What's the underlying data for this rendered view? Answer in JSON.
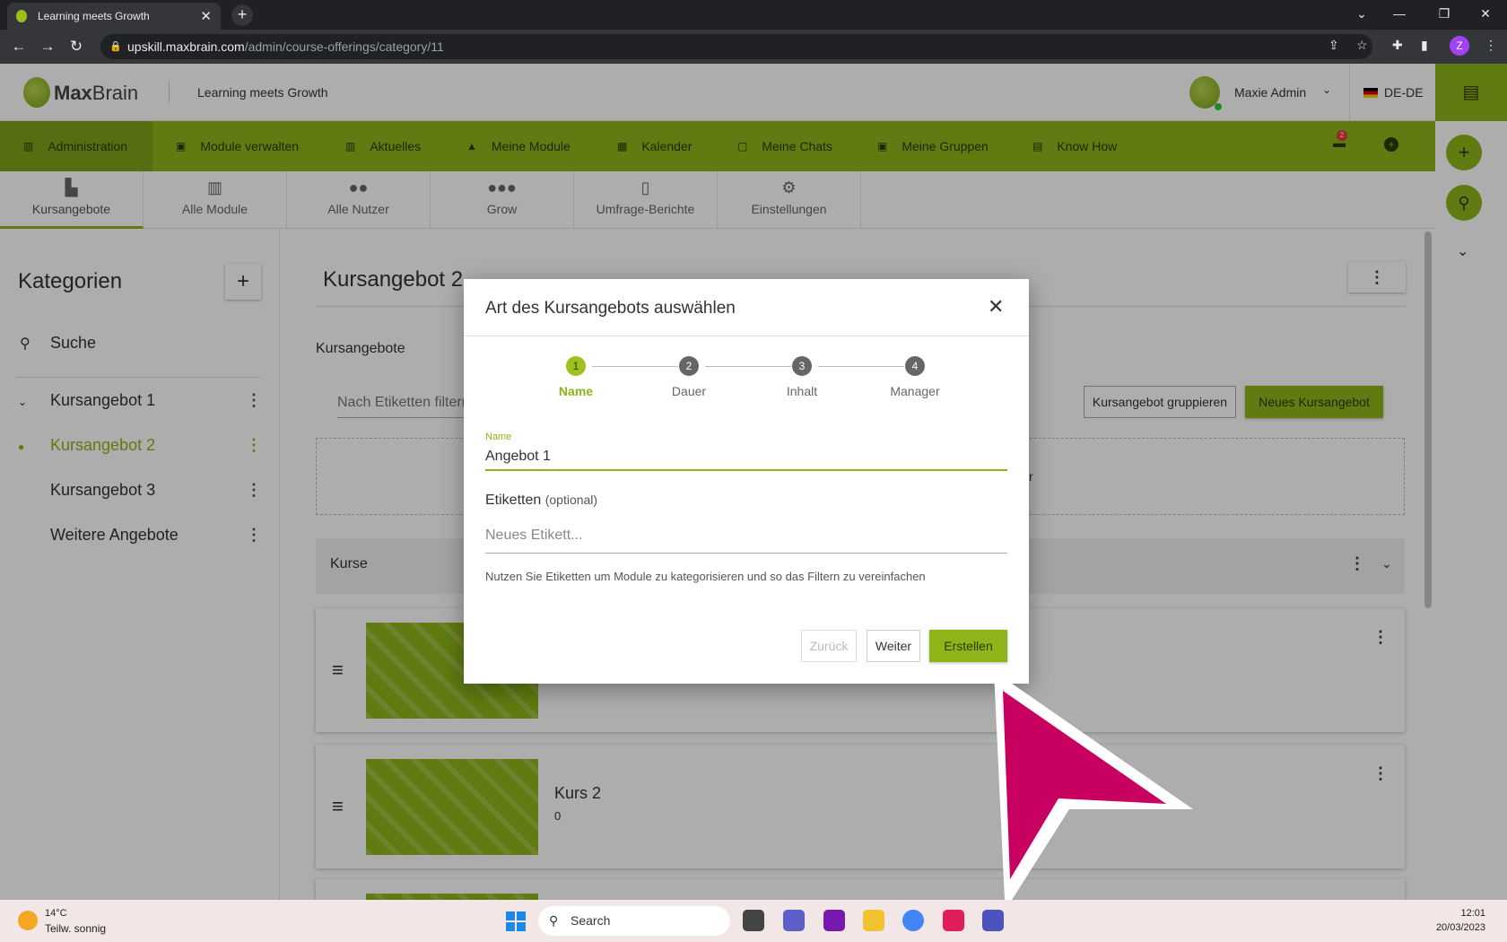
{
  "browser": {
    "tab_title": "Learning meets Growth",
    "url_host": "upskill.maxbrain.com",
    "url_path": "/admin/course-offerings/category/11",
    "profile_initial": "Z"
  },
  "header": {
    "logo_max": "Max",
    "logo_brain": "Brain",
    "tagline": "Learning meets Growth",
    "user_name": "Maxie Admin",
    "language": "DE-DE"
  },
  "nav": {
    "items": [
      {
        "label": "Administration"
      },
      {
        "label": "Module verwalten"
      },
      {
        "label": "Aktuelles"
      },
      {
        "label": "Meine Module"
      },
      {
        "label": "Kalender"
      },
      {
        "label": "Meine Chats"
      },
      {
        "label": "Meine Gruppen"
      },
      {
        "label": "Know How"
      }
    ],
    "notification_count": "2"
  },
  "subtabs": [
    {
      "label": "Kursangebote"
    },
    {
      "label": "Alle Module"
    },
    {
      "label": "Alle Nutzer"
    },
    {
      "label": "Grow"
    },
    {
      "label": "Umfrage-Berichte"
    },
    {
      "label": "Einstellungen"
    }
  ],
  "sidebar": {
    "title": "Kategorien",
    "search_label": "Suche",
    "items": [
      {
        "label": "Kursangebot 1"
      },
      {
        "label": "Kursangebot 2"
      },
      {
        "label": "Kursangebot 3"
      },
      {
        "label": "Weitere Angebote"
      }
    ]
  },
  "main": {
    "title": "Kursangebot 2",
    "subheading": "Kursangebote",
    "filter_placeholder": "Nach Etiketten filtern",
    "group_button": "Kursangebot gruppieren",
    "new_button": "Neues Kursangebot",
    "drop_fragment": "r",
    "section_label": "Kurse",
    "cards": [
      {
        "title": "",
        "subtitle": ""
      },
      {
        "title": "Kurs 2",
        "subtitle": "0"
      }
    ]
  },
  "modal": {
    "title": "Art des Kursangebots auswählen",
    "steps": [
      {
        "num": "1",
        "label": "Name"
      },
      {
        "num": "2",
        "label": "Dauer"
      },
      {
        "num": "3",
        "label": "Inhalt"
      },
      {
        "num": "4",
        "label": "Manager"
      }
    ],
    "name_label": "Name",
    "name_value": "Angebot 1",
    "tags_label": "Etiketten",
    "tags_optional": "(optional)",
    "tags_placeholder": "Neues Etikett...",
    "hint": "Nutzen Sie Etiketten um Module zu kategorisieren und so das Filtern zu vereinfachen",
    "back_button": "Zurück",
    "next_button": "Weiter",
    "create_button": "Erstellen"
  },
  "taskbar": {
    "temperature": "14°C",
    "weather": "Teilw. sonnig",
    "search_label": "Search",
    "time": "12:01",
    "date": "20/03/2023"
  },
  "colors": {
    "brand_green": "#8db51a",
    "cursor_magenta": "#c8005f"
  }
}
